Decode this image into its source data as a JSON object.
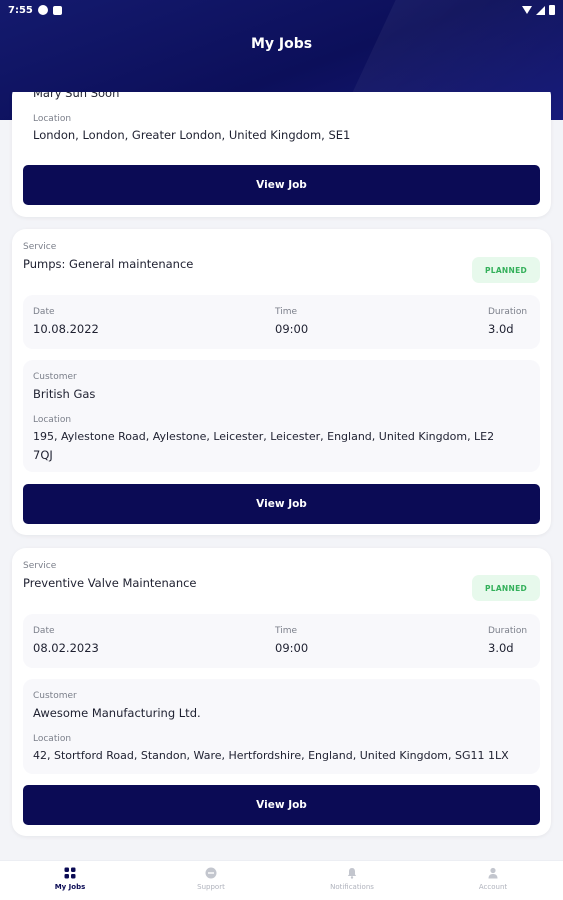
{
  "status_bar": {
    "time": "7:55"
  },
  "header": {
    "title": "My Jobs"
  },
  "cards": [
    {
      "customer_value": "Mary Sun Soon",
      "location_label": "Location",
      "location_value": "London, London, Greater London, United Kingdom, SE1",
      "button_label": "View Job"
    },
    {
      "service_label": "Service",
      "service_value": "Pumps: General maintenance",
      "status": "PLANNED",
      "date_label": "Date",
      "date_value": "10.08.2022",
      "time_label": "Time",
      "time_value": "09:00",
      "duration_label": "Duration",
      "duration_value": "3.0d",
      "customer_label": "Customer",
      "customer_value": "British Gas",
      "location_label": "Location",
      "location_line1": "195, Aylestone Road, Aylestone, Leicester, Leicester, England, United Kingdom, LE2",
      "location_line2": "7QJ",
      "button_label": "View Job"
    },
    {
      "service_label": "Service",
      "service_value": "Preventive Valve Maintenance",
      "status": "PLANNED",
      "date_label": "Date",
      "date_value": "08.02.2023",
      "time_label": "Time",
      "time_value": "09:00",
      "duration_label": "Duration",
      "duration_value": "3.0d",
      "customer_label": "Customer",
      "customer_value": "Awesome Manufacturing Ltd.",
      "location_label": "Location",
      "location_line1": "42, Stortford Road, Standon, Ware, Hertfordshire, England, United Kingdom, SG11 1LX",
      "button_label": "View Job"
    }
  ],
  "bottom_nav": [
    {
      "label": "My Jobs",
      "icon": "grid-icon",
      "active": true
    },
    {
      "label": "Support",
      "icon": "chat-icon",
      "active": false
    },
    {
      "label": "Notifications",
      "icon": "bell-icon",
      "active": false
    },
    {
      "label": "Account",
      "icon": "person-icon",
      "active": false
    }
  ],
  "colors": {
    "header": "#0c0f5a",
    "button": "#0b0b55",
    "badge_bg": "#e7f9ec",
    "badge_text": "#33b05a"
  }
}
